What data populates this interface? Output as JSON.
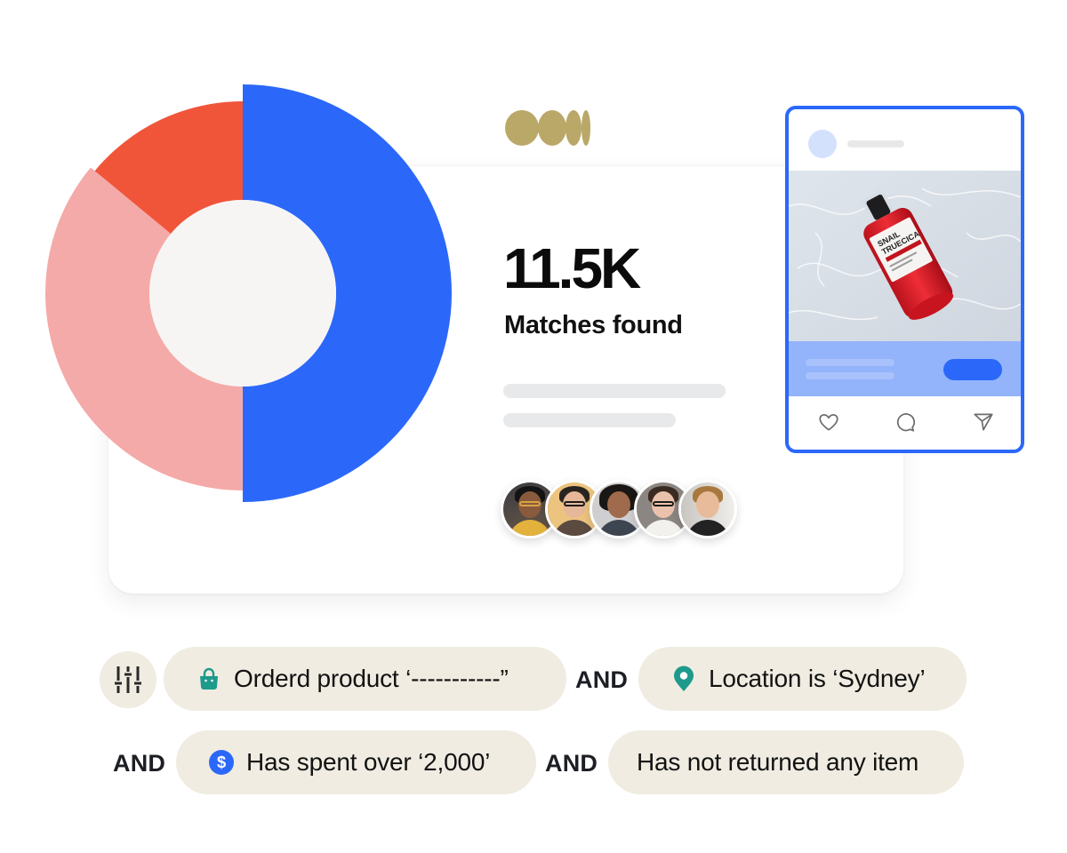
{
  "summary": {
    "stat_value": "11.5K",
    "stat_label": "Matches found"
  },
  "chart_data": {
    "type": "pie",
    "variant": "donut",
    "title": "",
    "slices": [
      {
        "name": "segment-1",
        "value": 50,
        "color": "#2b68fa"
      },
      {
        "name": "segment-2",
        "value": 36,
        "color": "#f4aaa8"
      },
      {
        "name": "segment-3",
        "value": 14,
        "color": "#f0553a"
      }
    ],
    "center_color": "#f7f5f4"
  },
  "brand": {
    "logo": "brand-logo-icon",
    "logo_color": "#b9a867"
  },
  "audience": {
    "avatars": [
      {
        "name": "avatar-1"
      },
      {
        "name": "avatar-2"
      },
      {
        "name": "avatar-3"
      },
      {
        "name": "avatar-4"
      },
      {
        "name": "avatar-5"
      }
    ]
  },
  "post_preview": {
    "product_image": "snail-truecica-serum-bottle",
    "product_label_line1": "SNAIL",
    "product_label_line2": "TRUECICA",
    "actions": [
      "heart-icon",
      "comment-icon",
      "send-icon"
    ],
    "accent_color": "#2b68fa"
  },
  "filters": {
    "settings_icon": "sliders-icon",
    "conditions": [
      {
        "icon": "shopping-bag-icon",
        "icon_color": "#1e9a8c",
        "label": "Orderd product ‘-----------”"
      },
      {
        "icon": "location-pin-icon",
        "icon_color": "#1e9a8c",
        "label": "Location is ‘Sydney’"
      },
      {
        "icon": "dollar-icon",
        "icon_color": "#2b68fa",
        "label": "Has spent over ‘2,000’"
      },
      {
        "icon": null,
        "label": "Has not returned any item"
      }
    ],
    "operators": [
      "AND",
      "AND",
      "AND"
    ]
  }
}
